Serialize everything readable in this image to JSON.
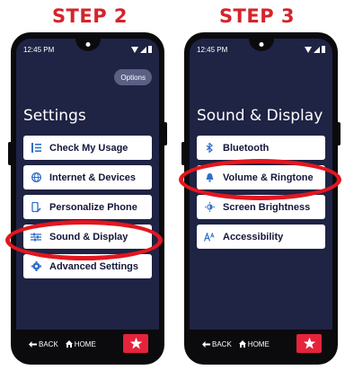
{
  "steps": [
    {
      "heading": "STEP 2",
      "status_time": "12:45 PM",
      "options_label": "Options",
      "screen_title": "Settings",
      "menu_items": [
        {
          "label": "Check My Usage",
          "icon": "list-icon"
        },
        {
          "label": "Internet & Devices",
          "icon": "globe-icon"
        },
        {
          "label": "Personalize Phone",
          "icon": "phone-brush-icon"
        },
        {
          "label": "Sound & Display",
          "icon": "sliders-icon",
          "highlighted": true
        },
        {
          "label": "Advanced Settings",
          "icon": "gear-icon"
        }
      ],
      "nav": {
        "back_label": "BACK",
        "home_label": "HOME"
      }
    },
    {
      "heading": "STEP 3",
      "status_time": "12:45 PM",
      "screen_title": "Sound & Display",
      "menu_items": [
        {
          "label": "Bluetooth",
          "icon": "bluetooth-icon"
        },
        {
          "label": "Volume & Ringtone",
          "icon": "bell-icon",
          "highlighted": true
        },
        {
          "label": "Screen Brightness",
          "icon": "sun-icon"
        },
        {
          "label": "Accessibility",
          "icon": "text-size-icon"
        }
      ],
      "nav": {
        "back_label": "BACK",
        "home_label": "HOME"
      }
    }
  ],
  "colors": {
    "accent_red": "#d6232c",
    "screen_bg": "#1f2344",
    "icon_blue": "#2f6fc8",
    "highlight_ring": "#e3161f"
  }
}
